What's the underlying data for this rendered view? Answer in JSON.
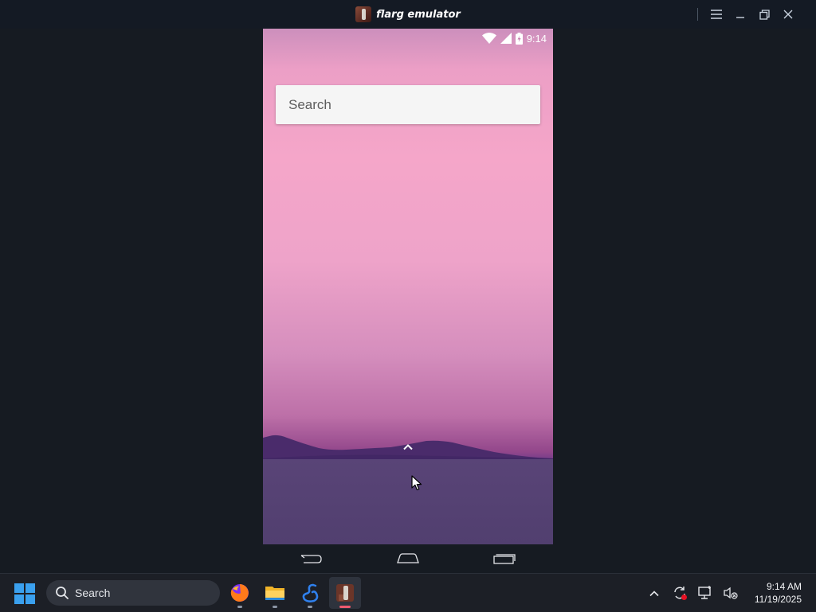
{
  "window": {
    "title": "flarg emulator",
    "icon": "flarg-app-icon",
    "controls": [
      "menu-icon",
      "minimize-icon",
      "restore-icon",
      "close-icon"
    ]
  },
  "phone": {
    "status_bar": {
      "icons": [
        "wifi-icon",
        "cellular-signal-icon",
        "battery-icon"
      ],
      "time": "9:14"
    },
    "search": {
      "placeholder": "Search"
    },
    "app_drawer_handle": "chevron-up-icon",
    "wallpaper_colors": {
      "sky_top": "#cc8fbc",
      "sky_mid": "#f5a6c9",
      "horizon": "#93478b",
      "mountains": "#4a2b6b",
      "water": "#594477"
    },
    "nav_bar": [
      "back-icon",
      "home-icon",
      "recents-icon"
    ]
  },
  "taskbar": {
    "start_icon": "windows-start-icon",
    "search_label": "Search",
    "pinned_apps": [
      {
        "icon": "firefox-icon",
        "active": false
      },
      {
        "icon": "file-explorer-icon",
        "active": false
      },
      {
        "icon": "swan-app-icon",
        "active": false
      },
      {
        "icon": "flarg-emulator-icon",
        "active": true
      }
    ],
    "tray_icons": [
      "chevron-up-icon",
      "sync-icon",
      "display-icon",
      "speaker-muted-icon"
    ],
    "clock": {
      "time": "9:14 AM",
      "date": "11/19/2025"
    },
    "accent_color": "#3aa0ee"
  }
}
